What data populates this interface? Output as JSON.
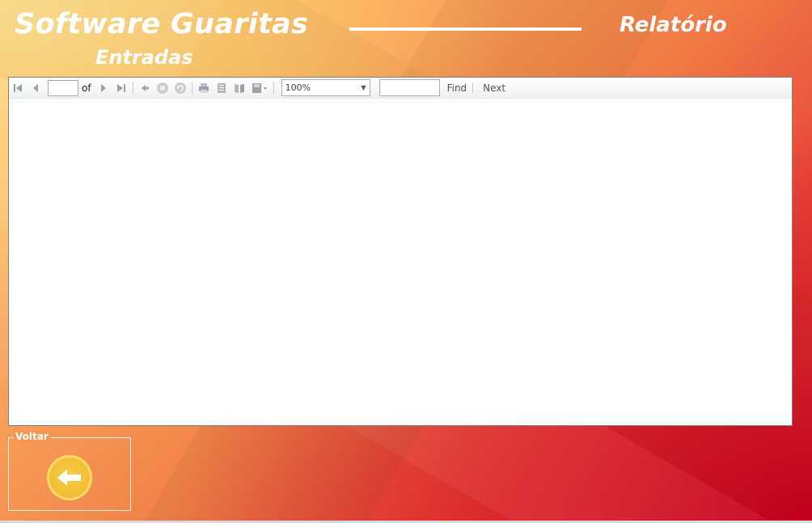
{
  "header": {
    "title": "Software Guaritas",
    "subtitle": "Entradas",
    "section": "Relatório"
  },
  "toolbar": {
    "page_value": "",
    "of_label": "of",
    "zoom_value": "100%",
    "find_value": "",
    "find_label": "Find",
    "next_label": "Next"
  },
  "back_group": {
    "label": "Voltar"
  },
  "colors": {
    "text": "#ffffff",
    "button": "#f1bf33"
  }
}
